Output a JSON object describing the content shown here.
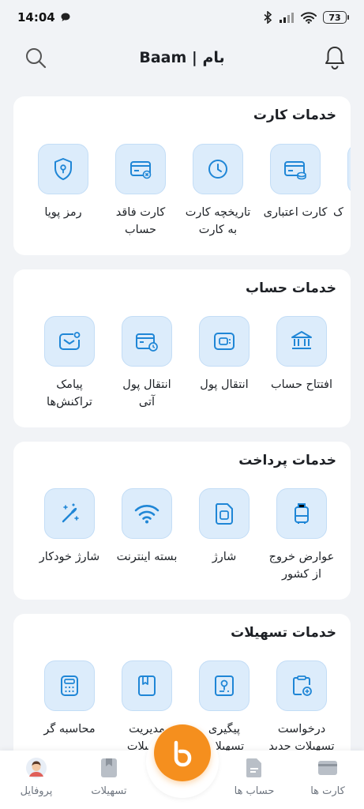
{
  "status_bar": {
    "time": "14:04",
    "battery": "73"
  },
  "header": {
    "title": "بام | Baam"
  },
  "colors": {
    "accent": "#1f86d6",
    "icon_bg": "#dcecfb",
    "fab": "#f58f1e"
  },
  "sections": [
    {
      "title": "خدمات کارت",
      "items": [
        {
          "label": "کارت اعتباری",
          "icon": "credit-card-coins-icon"
        },
        {
          "label": "تاریخچه کارت\nبه کارت",
          "icon": "clock-icon"
        },
        {
          "label": "کارت فاقد\nحساب",
          "icon": "card-x-icon"
        },
        {
          "label": "رمز پویا",
          "icon": "shield-key-icon"
        }
      ]
    },
    {
      "title": "خدمات حساب",
      "items": [
        {
          "label": "افتتاح حساب",
          "icon": "bank-icon"
        },
        {
          "label": "انتقال پول",
          "icon": "wallet-icon"
        },
        {
          "label": "انتقال پول\nآتی",
          "icon": "wallet-clock-icon"
        },
        {
          "label": "پیامک\nتراکنش‌ها",
          "icon": "message-notification-icon"
        }
      ]
    },
    {
      "title": "خدمات پرداخت",
      "items": [
        {
          "label": "عوارض خروج\nاز کشور",
          "icon": "luggage-icon"
        },
        {
          "label": "شارژ",
          "icon": "sim-card-icon"
        },
        {
          "label": "بسته اینترنت",
          "icon": "wifi-icon"
        },
        {
          "label": "شارژ خودکار",
          "icon": "magic-wand-icon"
        }
      ]
    },
    {
      "title": "خدمات تسهیلات",
      "items": [
        {
          "label": "درخواست\nتسهیلات جدید",
          "icon": "clipboard-add-icon"
        },
        {
          "label": "پیگیری\nتسهیلات",
          "icon": "document-search-icon"
        },
        {
          "label": "مدیریت\nتسهیلات",
          "icon": "book-icon"
        },
        {
          "label": "محاسبه گر",
          "icon": "calculator-icon"
        }
      ]
    }
  ],
  "bottom_nav": [
    {
      "label": "کارت ها",
      "icon": "card-icon"
    },
    {
      "label": "حساب ها",
      "icon": "document-icon"
    },
    {
      "label": "تسهیلات",
      "icon": "bookmark-icon"
    },
    {
      "label": "پروفایل",
      "icon": "avatar-icon"
    }
  ]
}
